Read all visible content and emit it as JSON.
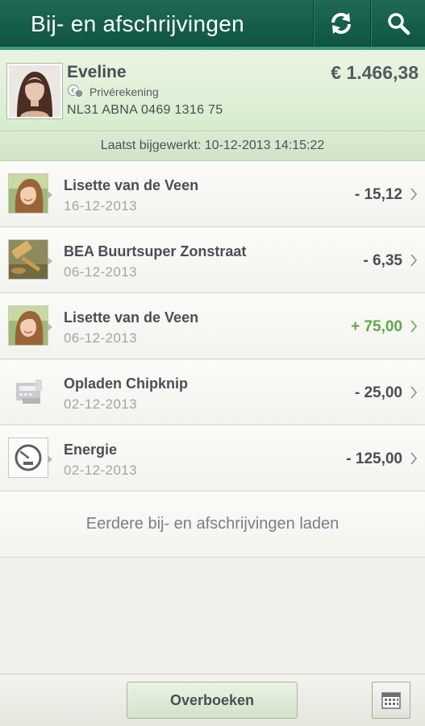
{
  "header": {
    "title": "Bij- en afschrijvingen",
    "refresh_icon": "refresh-icon",
    "search_icon": "search-icon"
  },
  "account": {
    "name": "Eveline",
    "type": "Privérekening",
    "iban": "NL31 ABNA 0469 1316 75",
    "balance": "€ 1.466,38"
  },
  "updated": {
    "text": "Laatst bijgewerkt: 10-12-2013 14:15:22"
  },
  "transactions": [
    {
      "name": "Lisette van de Veen",
      "date": "16-12-2013",
      "amount": "- 15,12",
      "type": "debit",
      "icon": "person-photo"
    },
    {
      "name": "BEA Buurtsuper Zonstraat",
      "date": "06-12-2013",
      "amount": "- 6,35",
      "type": "debit",
      "icon": "auction-gavel-photo"
    },
    {
      "name": "Lisette van de Veen",
      "date": "06-12-2013",
      "amount": "+ 75,00",
      "type": "credit",
      "icon": "person-photo"
    },
    {
      "name": "Opladen Chipknip",
      "date": "02-12-2013",
      "amount": "- 25,00",
      "type": "debit",
      "icon": "card-terminal-icon"
    },
    {
      "name": "Energie",
      "date": "02-12-2013",
      "amount": "- 125,00",
      "type": "debit",
      "icon": "energy-meter-icon"
    }
  ],
  "load_more": "Eerdere bij- en afschrijvingen laden",
  "footer": {
    "transfer_label": "Overboeken",
    "calendar_icon": "calendar-icon"
  },
  "colors": {
    "header": "#13594a",
    "positive": "#5fa84d",
    "account_bg": "#dff0d8"
  }
}
